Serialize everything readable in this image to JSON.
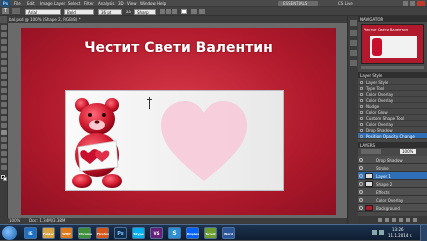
{
  "app": {
    "logo": "Ps",
    "workspace_button": "ESSENTIALS",
    "cslive": "CS Live"
  },
  "menu": [
    "File",
    "Edit",
    "Image",
    "Layer",
    "Select",
    "Filter",
    "Analysis",
    "3D",
    "View",
    "Window",
    "Help"
  ],
  "options_bar": {
    "font_family": "Arial",
    "font_style": "Bold",
    "font_size": "36 pt",
    "aa": "aa",
    "aa_mode": "Sharp"
  },
  "document": {
    "tab": "bal.psd @ 100% (Shape 2, RGB/8) *",
    "title": "Честит Свети Валентин",
    "status": "Doc: 1.34M/3.38M",
    "zoom": "100%",
    "colors": {
      "bg": "#b01a2c",
      "title": "#ffffff",
      "heart": "#f6c6d6"
    }
  },
  "panels": {
    "navigator_tab": "NAVIGATOR",
    "navigator_thumb_text": "Честит Свети Валентин",
    "styles_header": "Layer Style",
    "styles": [
      "Layer Style",
      "Type Tool",
      "Color Overlay",
      "Color Overlay",
      "Nudge",
      "Color Glow",
      "Custom Shape Tool",
      "Color Overlay",
      "Drop Shadow",
      "Position Opacity Change"
    ],
    "layers_tab": "LAYERS",
    "layers_opacity": "100%",
    "layers": [
      {
        "name": "Drop Shadow",
        "sub": true
      },
      {
        "name": "Stroke",
        "sub": true
      },
      {
        "name": "Layer 1",
        "selected": true
      },
      {
        "name": "Shape 2",
        "sub": false
      },
      {
        "name": "Effects",
        "sub": true
      },
      {
        "name": "Color Overlay",
        "sub": true
      },
      {
        "name": "Background",
        "sub": false
      }
    ]
  },
  "taskbar": {
    "apps": [
      "IE",
      "Folder",
      "WMP",
      "Chrome",
      "Firefox",
      "Ps",
      "Skype",
      "VS",
      "S",
      "Dropbox",
      "Torrent",
      "Word"
    ],
    "tray_time": "13:26",
    "tray_date": "11.1.2014 r."
  }
}
